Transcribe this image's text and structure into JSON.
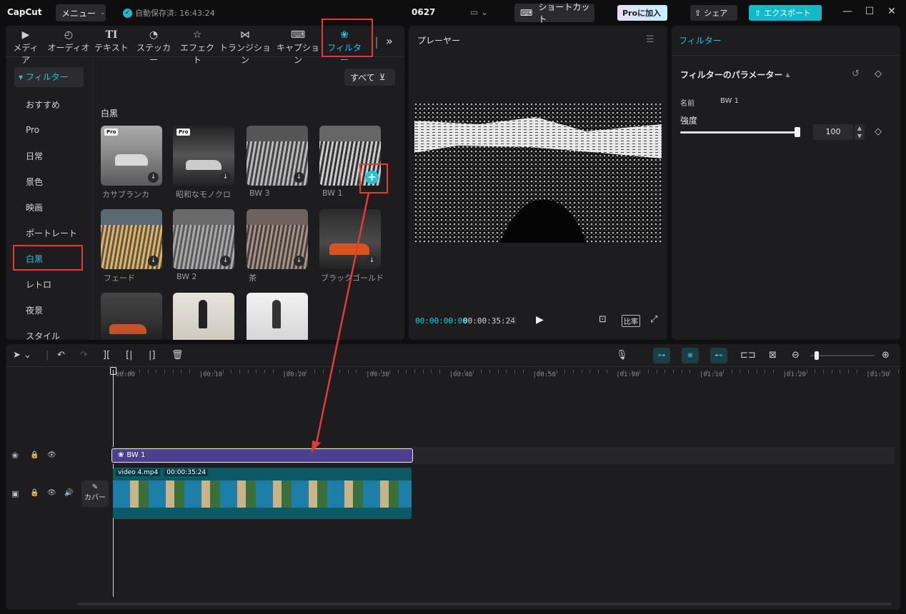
{
  "app": {
    "logo": "CapCut",
    "menu_label": "メニュー",
    "autosave_text": "自動保存済: 16:43:24",
    "project_name": "0627",
    "shortcut_label": "ショートカット",
    "pro_label": "Proに加入",
    "share_label": "シェア",
    "export_label": "エクスポート"
  },
  "tool_tabs": [
    {
      "label": "メディア",
      "icon": "media-icon"
    },
    {
      "label": "オーディオ",
      "icon": "audio-icon"
    },
    {
      "label": "テキスト",
      "icon": "text-icon"
    },
    {
      "label": "ステッカー",
      "icon": "sticker-icon"
    },
    {
      "label": "エフェクト",
      "icon": "effect-icon"
    },
    {
      "label": "トランジション",
      "icon": "transition-icon"
    },
    {
      "label": "キャプション",
      "icon": "caption-icon"
    },
    {
      "label": "フィルター",
      "icon": "filter-icon",
      "active": true
    }
  ],
  "sidebar": {
    "header": "▾ フィルター",
    "items": [
      "おすすめ",
      "Pro",
      "日常",
      "景色",
      "映画",
      "ポートレート",
      "白黒",
      "レトロ",
      "夜景",
      "スタイル"
    ],
    "selected": "白黒"
  },
  "filters": {
    "sort_label": "すべて",
    "section_title": "白黒",
    "items": [
      {
        "label": "カサブランカ",
        "pro": true
      },
      {
        "label": "昭和なモノクロ",
        "pro": true
      },
      {
        "label": "BW 3",
        "pro": false
      },
      {
        "label": "BW 1",
        "pro": false
      },
      {
        "label": "フェード",
        "pro": false
      },
      {
        "label": "BW 2",
        "pro": false
      },
      {
        "label": "茶",
        "pro": false
      },
      {
        "label": "ブラックゴールド",
        "pro": false
      },
      {
        "label": "",
        "pro": false
      },
      {
        "label": "",
        "pro": false
      },
      {
        "label": "",
        "pro": false
      }
    ],
    "pro_badge": "Pro"
  },
  "player": {
    "title": "プレーヤー",
    "current_time": "00:00:00:00",
    "total_time": "00:00:35:24",
    "ratio_label": "比率"
  },
  "inspector": {
    "tab": "フィルター",
    "section_title": "フィルターのパラメーター",
    "name_label": "名前",
    "name_value": "BW 1",
    "strength_label": "強度",
    "strength_value": "100",
    "strength_fraction": 1.0
  },
  "timeline": {
    "ruler": [
      "00:00",
      "|00:10",
      "|00:20",
      "|00:30",
      "|00:40",
      "|00:50",
      "|01:00",
      "|01:10",
      "|01:20",
      "|01:30"
    ],
    "filter_clip": "BW 1",
    "video_name": "video 4.mp4",
    "video_duration": "00:00:35:24",
    "cover_label": "カバー"
  },
  "colors": {
    "accent": "#22c5d4",
    "filter_clip": "#4b3f8e",
    "highlight_box": "#e53935"
  }
}
